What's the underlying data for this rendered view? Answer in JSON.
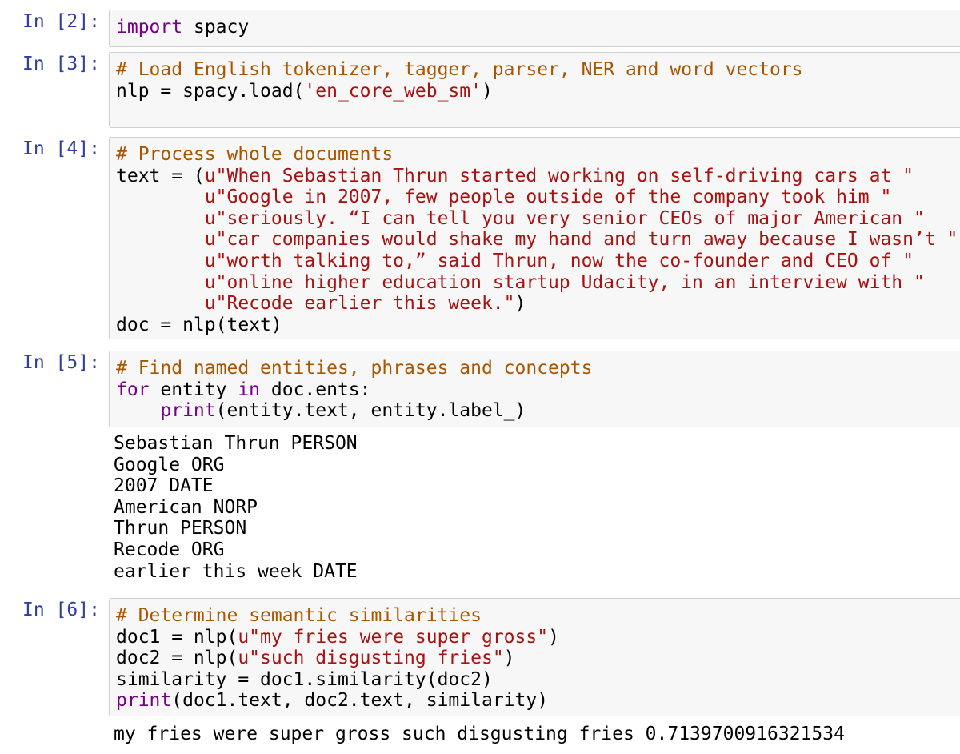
{
  "colors": {
    "prompt": "#303f9f",
    "comment": "#aa5500",
    "keyword": "#770088",
    "string": "#aa1111",
    "cell_background": "#f7f7f7",
    "cell_border": "#cfcfcf"
  },
  "cells": [
    {
      "prompt": "In [2]:",
      "lines": [
        [
          {
            "t": "keyword",
            "s": "import"
          },
          {
            "t": "plain",
            "s": " spacy"
          }
        ]
      ],
      "output": []
    },
    {
      "prompt": "In [3]:",
      "lines": [
        [
          {
            "t": "comment",
            "s": "# Load English tokenizer, tagger, parser, NER and word vectors"
          }
        ],
        [
          {
            "t": "plain",
            "s": "nlp = spacy.load("
          },
          {
            "t": "string",
            "s": "'en_core_web_sm'"
          },
          {
            "t": "plain",
            "s": ")"
          }
        ]
      ],
      "output": []
    },
    {
      "prompt": "In [4]:",
      "lines": [
        [
          {
            "t": "comment",
            "s": "# Process whole documents"
          }
        ],
        [
          {
            "t": "plain",
            "s": "text = ("
          },
          {
            "t": "string",
            "s": "u\"When Sebastian Thrun started working on self-driving cars at \""
          }
        ],
        [
          {
            "t": "plain",
            "s": "        "
          },
          {
            "t": "string",
            "s": "u\"Google in 2007, few people outside of the company took him \""
          }
        ],
        [
          {
            "t": "plain",
            "s": "        "
          },
          {
            "t": "string",
            "s": "u\"seriously. “I can tell you very senior CEOs of major American \""
          }
        ],
        [
          {
            "t": "plain",
            "s": "        "
          },
          {
            "t": "string",
            "s": "u\"car companies would shake my hand and turn away because I wasn’t \""
          }
        ],
        [
          {
            "t": "plain",
            "s": "        "
          },
          {
            "t": "string",
            "s": "u\"worth talking to,” said Thrun, now the co-founder and CEO of \""
          }
        ],
        [
          {
            "t": "plain",
            "s": "        "
          },
          {
            "t": "string",
            "s": "u\"online higher education startup Udacity, in an interview with \""
          }
        ],
        [
          {
            "t": "plain",
            "s": "        "
          },
          {
            "t": "string",
            "s": "u\"Recode earlier this week.\""
          },
          {
            "t": "plain",
            "s": ")"
          }
        ],
        [
          {
            "t": "plain",
            "s": "doc = nlp(text)"
          }
        ]
      ],
      "output": []
    },
    {
      "prompt": "In [5]:",
      "lines": [
        [
          {
            "t": "comment",
            "s": "# Find named entities, phrases and concepts"
          }
        ],
        [
          {
            "t": "keyword",
            "s": "for"
          },
          {
            "t": "plain",
            "s": " entity "
          },
          {
            "t": "keyword",
            "s": "in"
          },
          {
            "t": "plain",
            "s": " doc.ents:"
          }
        ],
        [
          {
            "t": "plain",
            "s": "    "
          },
          {
            "t": "builtin",
            "s": "print"
          },
          {
            "t": "plain",
            "s": "(entity.text, entity.label_)"
          }
        ]
      ],
      "output": [
        "Sebastian Thrun PERSON",
        "Google ORG",
        "2007 DATE",
        "American NORP",
        "Thrun PERSON",
        "Recode ORG",
        "earlier this week DATE"
      ]
    },
    {
      "prompt": "In [6]:",
      "lines": [
        [
          {
            "t": "comment",
            "s": "# Determine semantic similarities"
          }
        ],
        [
          {
            "t": "plain",
            "s": "doc1 = nlp("
          },
          {
            "t": "string",
            "s": "u\"my fries were super gross\""
          },
          {
            "t": "plain",
            "s": ")"
          }
        ],
        [
          {
            "t": "plain",
            "s": "doc2 = nlp("
          },
          {
            "t": "string",
            "s": "u\"such disgusting fries\""
          },
          {
            "t": "plain",
            "s": ")"
          }
        ],
        [
          {
            "t": "plain",
            "s": "similarity = doc1.similarity(doc2)"
          }
        ],
        [
          {
            "t": "builtin",
            "s": "print"
          },
          {
            "t": "plain",
            "s": "(doc1.text, doc2.text, similarity)"
          }
        ]
      ],
      "output": [
        "my fries were super gross such disgusting fries 0.7139700916321534"
      ]
    }
  ]
}
